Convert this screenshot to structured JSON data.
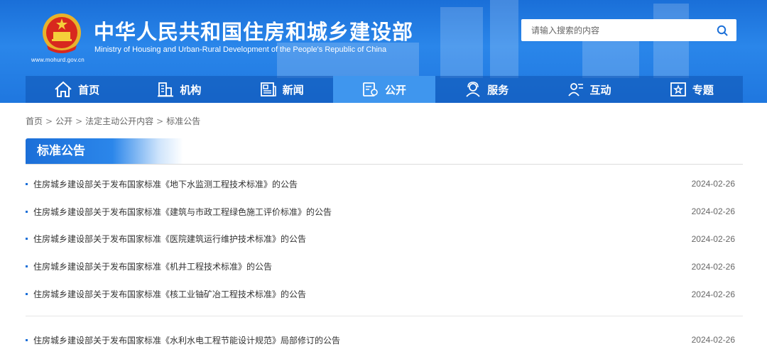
{
  "header": {
    "site_title": "中华人民共和国住房和城乡建设部",
    "site_subtitle": "Ministry of Housing and Urban-Rural Development of the People's Republic of China",
    "site_url": "www.mohurd.gov.cn",
    "emblem_icon": "national-emblem-icon",
    "search": {
      "placeholder": "请输入搜索的内容",
      "value": "",
      "icon": "search-icon"
    }
  },
  "nav": {
    "items": [
      {
        "label": "首页",
        "icon": "home-icon",
        "active": false
      },
      {
        "label": "机构",
        "icon": "building-icon",
        "active": false
      },
      {
        "label": "新闻",
        "icon": "news-icon",
        "active": false
      },
      {
        "label": "公开",
        "icon": "document-icon",
        "active": true
      },
      {
        "label": "服务",
        "icon": "service-icon",
        "active": false
      },
      {
        "label": "互动",
        "icon": "interaction-icon",
        "active": false
      },
      {
        "label": "专题",
        "icon": "star-icon",
        "active": false
      }
    ]
  },
  "breadcrumb": {
    "items": [
      "首页",
      "公开",
      "法定主动公开内容",
      "标准公告"
    ],
    "separator": ">"
  },
  "section": {
    "title": "标准公告"
  },
  "list": {
    "group1": [
      {
        "title": "住房城乡建设部关于发布国家标准《地下水监测工程技术标准》的公告",
        "date": "2024-02-26"
      },
      {
        "title": "住房城乡建设部关于发布国家标准《建筑与市政工程绿色施工评价标准》的公告",
        "date": "2024-02-26"
      },
      {
        "title": "住房城乡建设部关于发布国家标准《医院建筑运行维护技术标准》的公告",
        "date": "2024-02-26"
      },
      {
        "title": "住房城乡建设部关于发布国家标准《机井工程技术标准》的公告",
        "date": "2024-02-26"
      },
      {
        "title": "住房城乡建设部关于发布国家标准《核工业铀矿冶工程技术标准》的公告",
        "date": "2024-02-26"
      }
    ],
    "group2": [
      {
        "title": "住房城乡建设部关于发布国家标准《水利水电工程节能设计规范》局部修订的公告",
        "date": "2024-02-26"
      }
    ]
  },
  "colors": {
    "primary": "#1a6fd8",
    "nav_active": "#3f96ee",
    "text": "#333333",
    "muted": "#666666"
  }
}
